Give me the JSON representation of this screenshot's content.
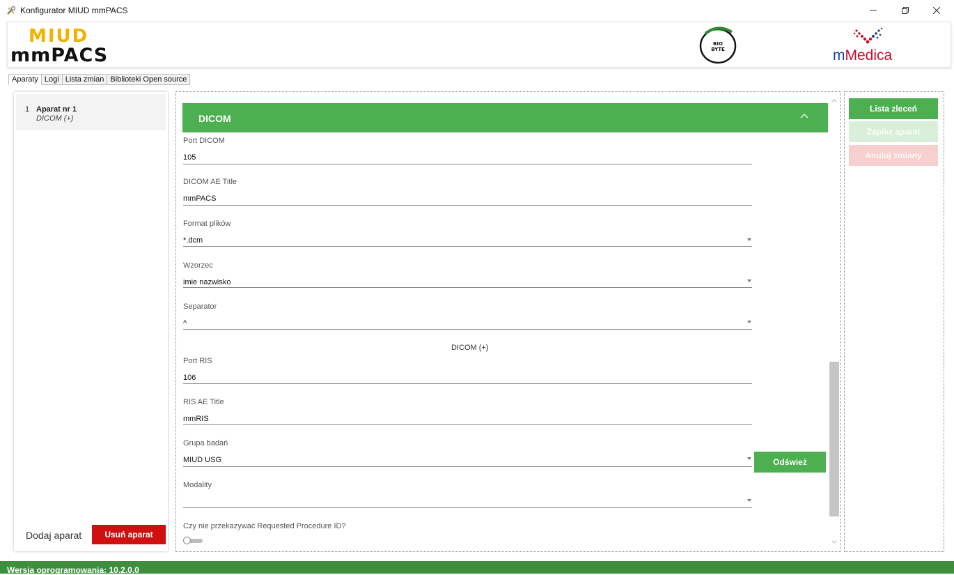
{
  "window": {
    "title": "Konfigurator MIUD mmPACS",
    "minimize_icon": "minimize-icon",
    "restore_icon": "restore-icon",
    "close_icon": "close-icon"
  },
  "header": {
    "logo_miud": "MIUD",
    "logo_mmpacs": "mmPACS",
    "logo_biobyte": "BIO BYTE",
    "logo_mmedica_m": "m",
    "logo_mmedica_rest": "Medica"
  },
  "tabs": [
    {
      "label": "Aparaty",
      "active": true
    },
    {
      "label": "Logi",
      "active": false
    },
    {
      "label": "Lista zmian",
      "active": false
    },
    {
      "label": "Biblioteki Open source",
      "active": false
    }
  ],
  "devices": {
    "items": [
      {
        "num": "1",
        "name": "Aparat nr 1",
        "sub": "DICOM (+)"
      }
    ],
    "add_label": "Dodaj aparat",
    "delete_label": "Usuń aparat"
  },
  "section": {
    "title": "DICOM",
    "fields": [
      {
        "label": "Port DICOM",
        "value": "105"
      },
      {
        "label": "DICOM AE Title",
        "value": "mmPACS"
      },
      {
        "label": "Format plików",
        "value": "*.dcm"
      },
      {
        "label": "Wzorzec",
        "value": "imie nazwisko"
      },
      {
        "label": "Separator",
        "value": "^"
      }
    ],
    "note": "DICOM (+)",
    "fields2": [
      {
        "label": "Port RIS",
        "value": "106"
      },
      {
        "label": "RIS AE Title",
        "value": "mmRIS"
      },
      {
        "label": "Grupa badań",
        "value": "MIUD USG"
      },
      {
        "label": "Modality",
        "value": ""
      }
    ],
    "refresh_label": "Odśwież",
    "toggle_label": "Czy nie przekazywać Requested Procedure ID?",
    "toggle_on": false
  },
  "actions": {
    "orders_label": "Lista zleceń",
    "save_label": "Zapisz aparat",
    "cancel_label": "Anuluj zmiany"
  },
  "status": {
    "version": "Wersja oprogramowania: 10.2.0.0"
  },
  "colors": {
    "accent_green": "#4caf50",
    "danger_red": "#d01010",
    "status_green": "#3e8e3e"
  }
}
